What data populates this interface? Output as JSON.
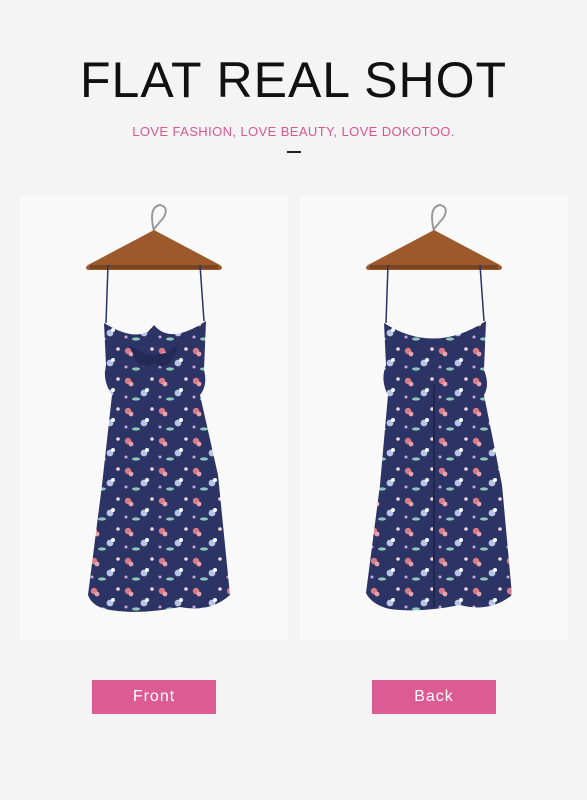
{
  "header": {
    "title": "FLAT REAL SHOT",
    "subtitle": "LOVE FASHION, LOVE BEAUTY, LOVE DOKOTOO."
  },
  "photos": [
    {
      "name": "front-dress-photo",
      "view": "front"
    },
    {
      "name": "back-dress-photo",
      "view": "back"
    }
  ],
  "buttons": {
    "front_label": "Front",
    "back_label": "Back"
  },
  "colors": {
    "accent": "#dd5b93",
    "subtitle": "#d9568f",
    "dress": "#2c3365",
    "background": "#f4f4f4"
  }
}
